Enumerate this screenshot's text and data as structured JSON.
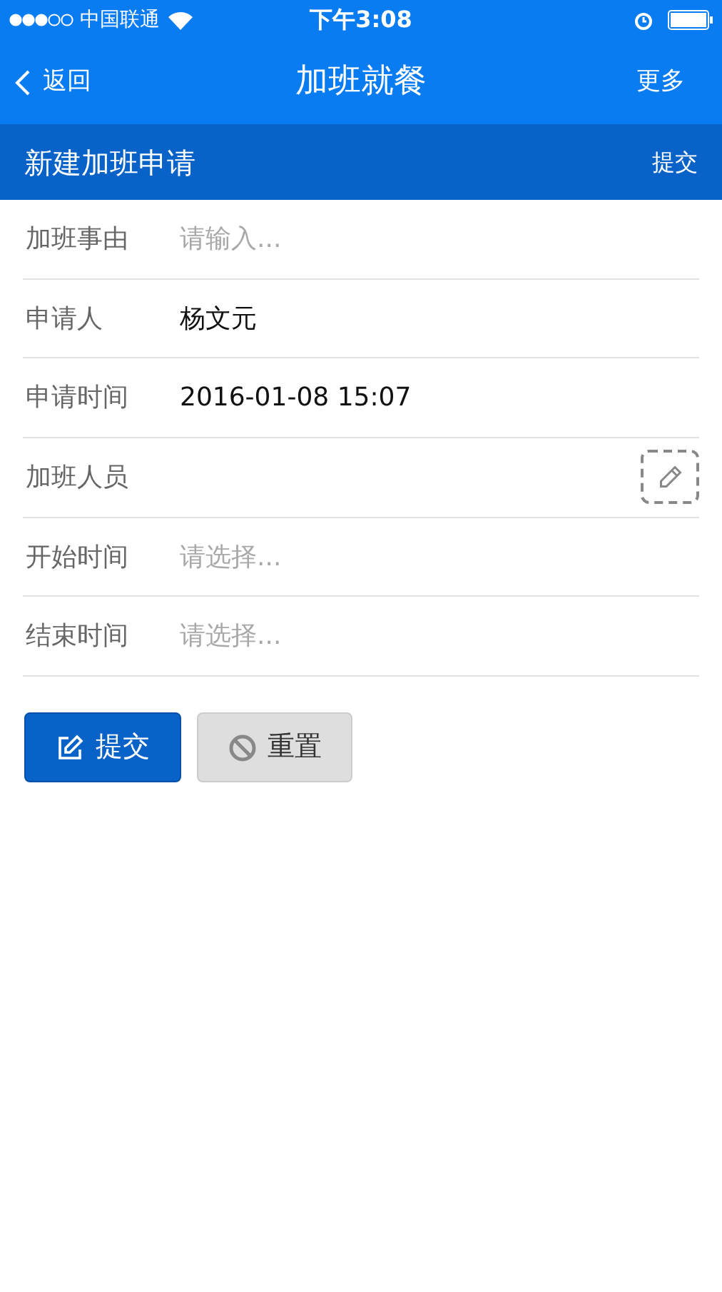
{
  "status_bar": {
    "carrier": "中国联通",
    "time": "下午3:08"
  },
  "nav": {
    "back": "返回",
    "title": "加班就餐",
    "more": "更多"
  },
  "header": {
    "title": "新建加班申请",
    "action": "提交"
  },
  "fields": [
    {
      "kind": "input",
      "label": "加班事由",
      "placeholder": "请输入..."
    },
    {
      "kind": "text",
      "label": "申请人",
      "value": "杨文元"
    },
    {
      "kind": "text",
      "label": "申请时间",
      "value": "2016-01-08 15:07"
    },
    {
      "kind": "people",
      "label": "加班人员"
    },
    {
      "kind": "picker",
      "label": "开始时间",
      "placeholder": "请选择..."
    },
    {
      "kind": "picker",
      "label": "结束时间",
      "placeholder": "请选择..."
    }
  ],
  "buttons": [
    {
      "kind": "primary",
      "label": "提交"
    },
    {
      "kind": "secondary",
      "label": "重置"
    }
  ]
}
